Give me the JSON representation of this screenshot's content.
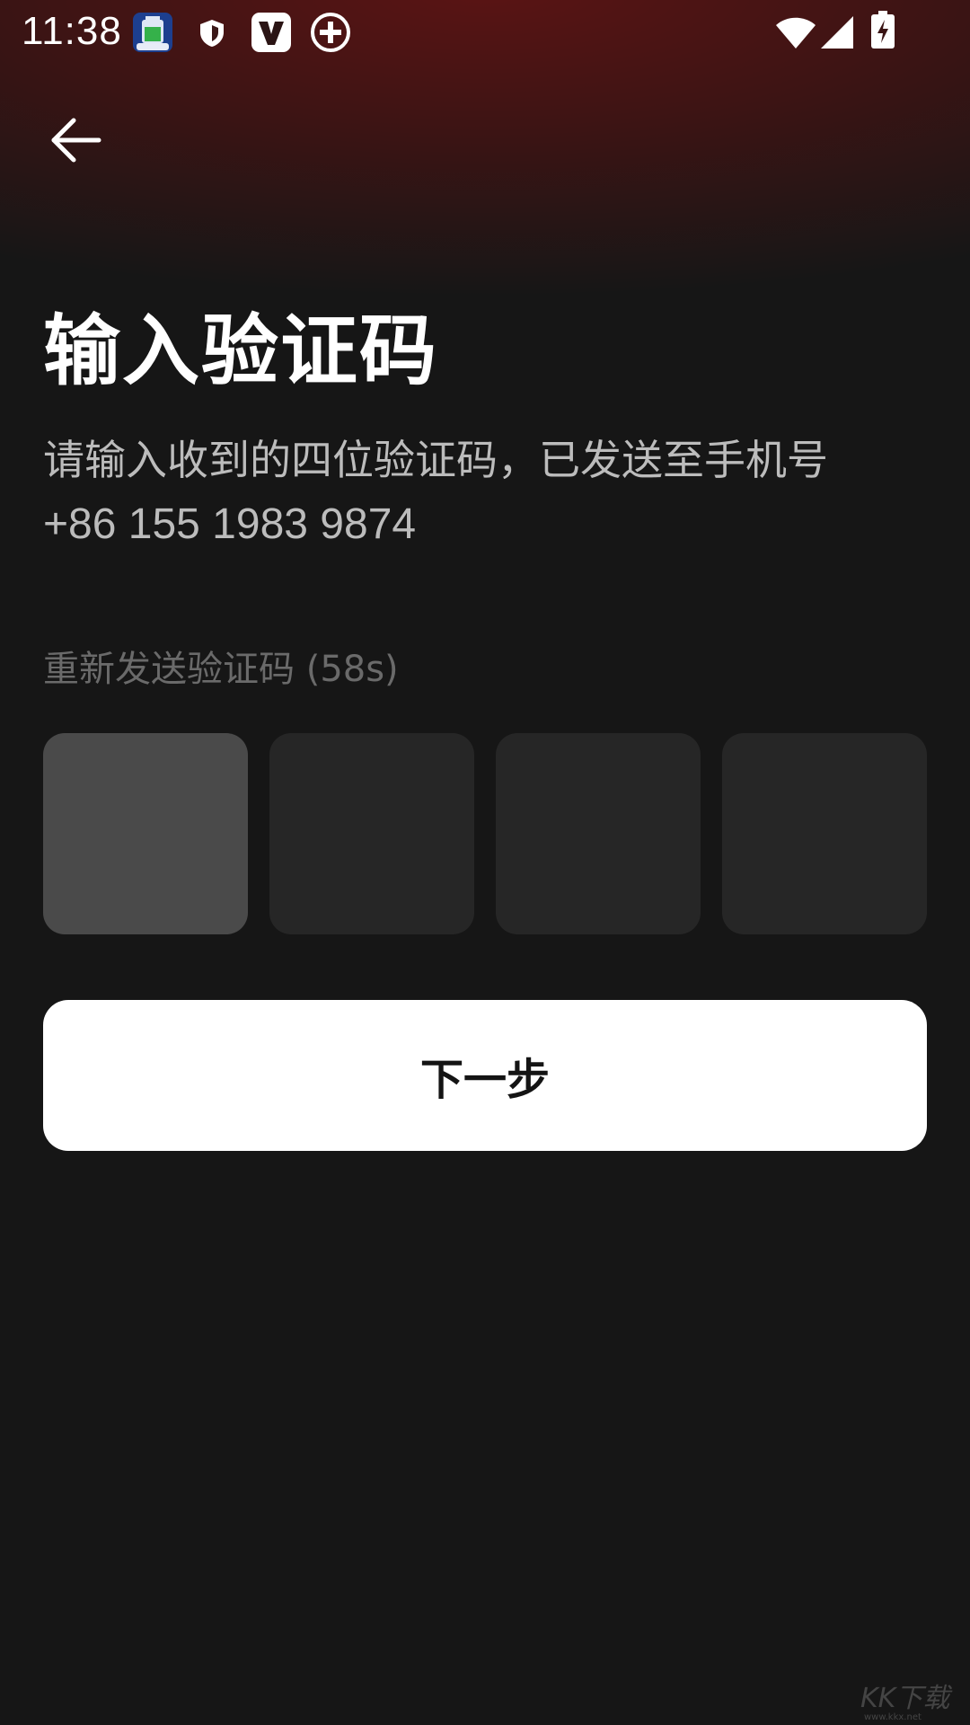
{
  "status_bar": {
    "time": "11:38",
    "icons": [
      "battery-app-icon",
      "shield-icon",
      "v-app-icon",
      "plus-circle-icon",
      "wifi-icon",
      "signal-icon",
      "battery-charging-icon"
    ]
  },
  "header": {
    "back_icon": "arrow-left-icon"
  },
  "main": {
    "title": "输入验证码",
    "subtitle_line1": "请输入收到的四位验证码，已发送至手机号",
    "phone_number": "+86 155 1983 9874",
    "resend_label": "重新发送验证码 (58s)",
    "code_digits": [
      "",
      "",
      "",
      ""
    ],
    "active_index": 0,
    "next_button_label": "下一步"
  },
  "colors": {
    "background": "#161616",
    "gradient_top": "#5a1414",
    "code_box": "#262626",
    "code_box_active": "#4a4a4a",
    "button_bg": "#ffffff",
    "button_text": "#141414"
  }
}
